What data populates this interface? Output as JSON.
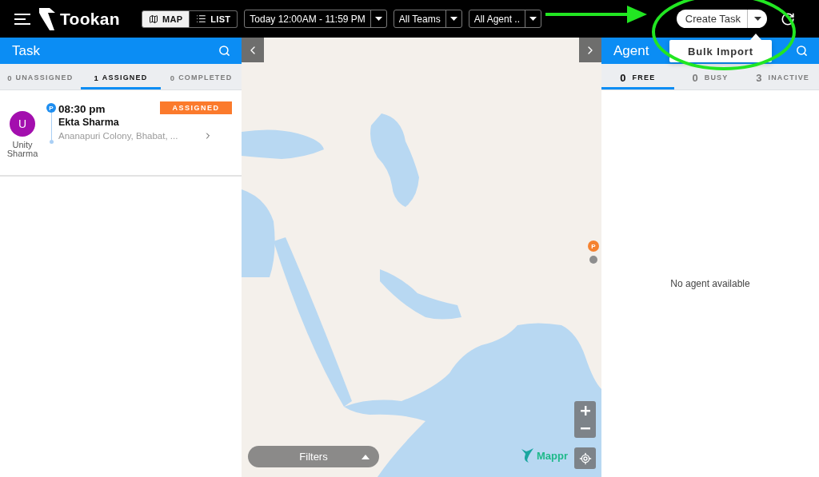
{
  "top_bar": {
    "logo_text": "Tookan",
    "view_toggle": [
      {
        "kind": "map",
        "label": "MAP",
        "selected": true
      },
      {
        "kind": "list",
        "label": "LIST",
        "selected": false
      }
    ],
    "filters": [
      {
        "label": "Today 12:00AM - 11:59 PM"
      },
      {
        "label": "All Teams"
      },
      {
        "label": "All Agent .."
      }
    ],
    "create_task": {
      "label": "Create Task",
      "menu": [
        {
          "label": "Bulk Import"
        }
      ]
    }
  },
  "task_panel": {
    "title": "Task",
    "tabs": [
      {
        "count": "0",
        "label": "UNASSIGNED",
        "selected": false
      },
      {
        "count": "1",
        "label": "ASSIGNED",
        "selected": true
      },
      {
        "count": "0",
        "label": "COMPLETED",
        "selected": false
      }
    ],
    "tasks": [
      {
        "avatar_initial": "U",
        "agent_name": "Unity Sharma",
        "marker": "P",
        "time": "08:30 pm",
        "customer": "Ekta Sharma",
        "address": "Ananapuri Colony, Bhabat, ...",
        "status": "ASSIGNED"
      }
    ]
  },
  "map": {
    "marker": "P",
    "filters_label": "Filters",
    "brand": "Mappr"
  },
  "agent_panel": {
    "title": "Agent",
    "tabs": [
      {
        "count": "0",
        "label": "FREE",
        "selected": true
      },
      {
        "count": "0",
        "label": "BUSY",
        "selected": false
      },
      {
        "count": "3",
        "label": "INACTIVE",
        "selected": false
      }
    ],
    "empty_message": "No agent available"
  }
}
